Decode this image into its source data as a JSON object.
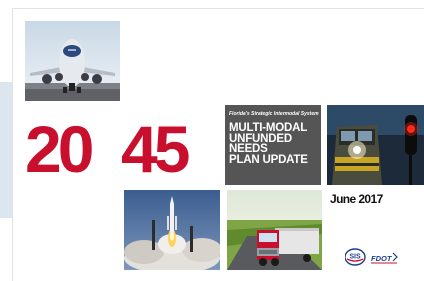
{
  "cover": {
    "year_part1": "20",
    "year_part2": "45",
    "subtitle": "Florida's Strategic Intermodal System",
    "title_lines": [
      "MULTI-MODAL",
      "UNFUNDED",
      "NEEDS",
      "PLAN UPDATE"
    ],
    "date": "June 2017"
  },
  "logos": {
    "sis": "SIS",
    "fdot": "FDOT"
  },
  "images": [
    "airplane",
    "train",
    "rocket-launch",
    "truck"
  ],
  "colors": {
    "accent_red": "#c8102e",
    "title_box": "#555555",
    "side_band": "#dbe6ef"
  }
}
